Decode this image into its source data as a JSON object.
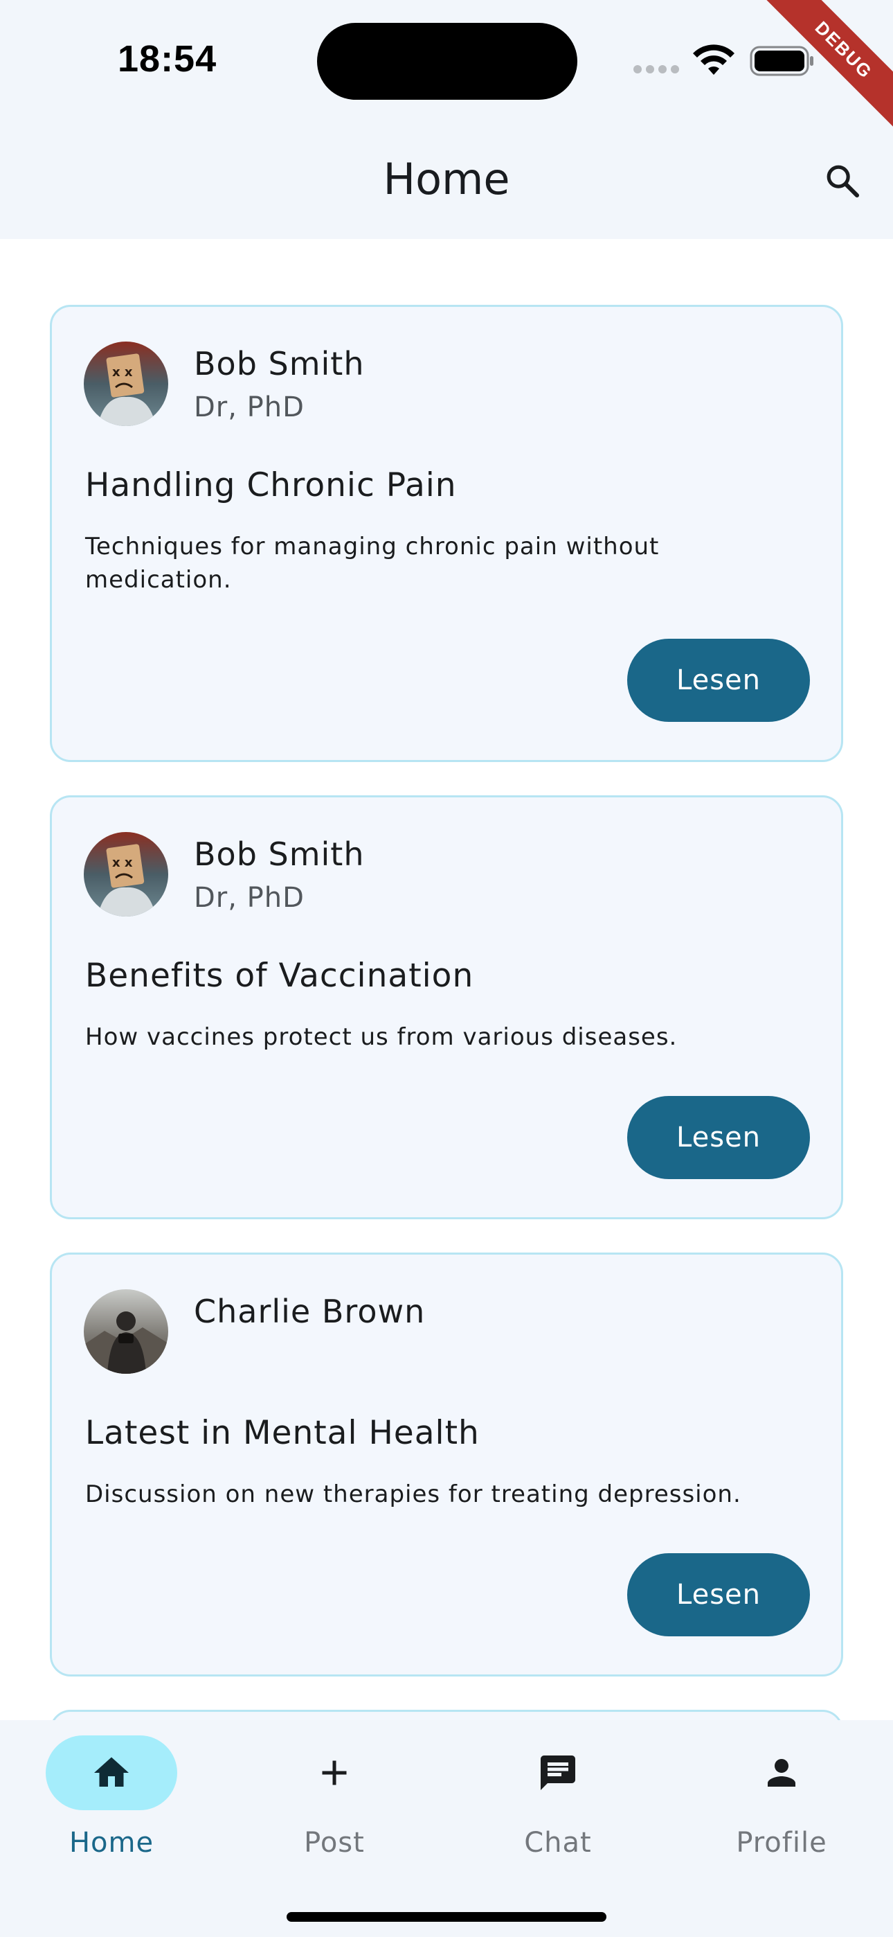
{
  "status_bar": {
    "time": "18:54"
  },
  "debug_banner": "DEBUG",
  "app_bar": {
    "title": "Home",
    "search_icon": "search-icon"
  },
  "posts": [
    {
      "author": "Bob Smith",
      "author_title": "Dr, PhD",
      "title": "Handling Chronic Pain",
      "description": "Techniques for managing chronic pain without medication.",
      "button": "Lesen",
      "avatar": "avatar-boxhead"
    },
    {
      "author": "Bob Smith",
      "author_title": "Dr, PhD",
      "title": "Benefits of Vaccination",
      "description": "How vaccines protect us from various diseases.",
      "button": "Lesen",
      "avatar": "avatar-boxhead"
    },
    {
      "author": "Charlie Brown",
      "author_title": "",
      "title": "Latest in Mental Health",
      "description": "Discussion on new therapies for treating depression.",
      "button": "Lesen",
      "avatar": "avatar-photographer"
    }
  ],
  "bottom_nav": {
    "active": "Home",
    "items": [
      {
        "label": "Home",
        "icon": "home-icon"
      },
      {
        "label": "Post",
        "icon": "plus-icon"
      },
      {
        "label": "Chat",
        "icon": "chat-icon"
      },
      {
        "label": "Profile",
        "icon": "person-icon"
      }
    ]
  },
  "colors": {
    "accent": "#1a6789",
    "card_background": "#f3f7fd",
    "card_border": "#b7e5f3",
    "nav_indicator": "#a5edfb",
    "bar_background": "#f2f6fb"
  }
}
